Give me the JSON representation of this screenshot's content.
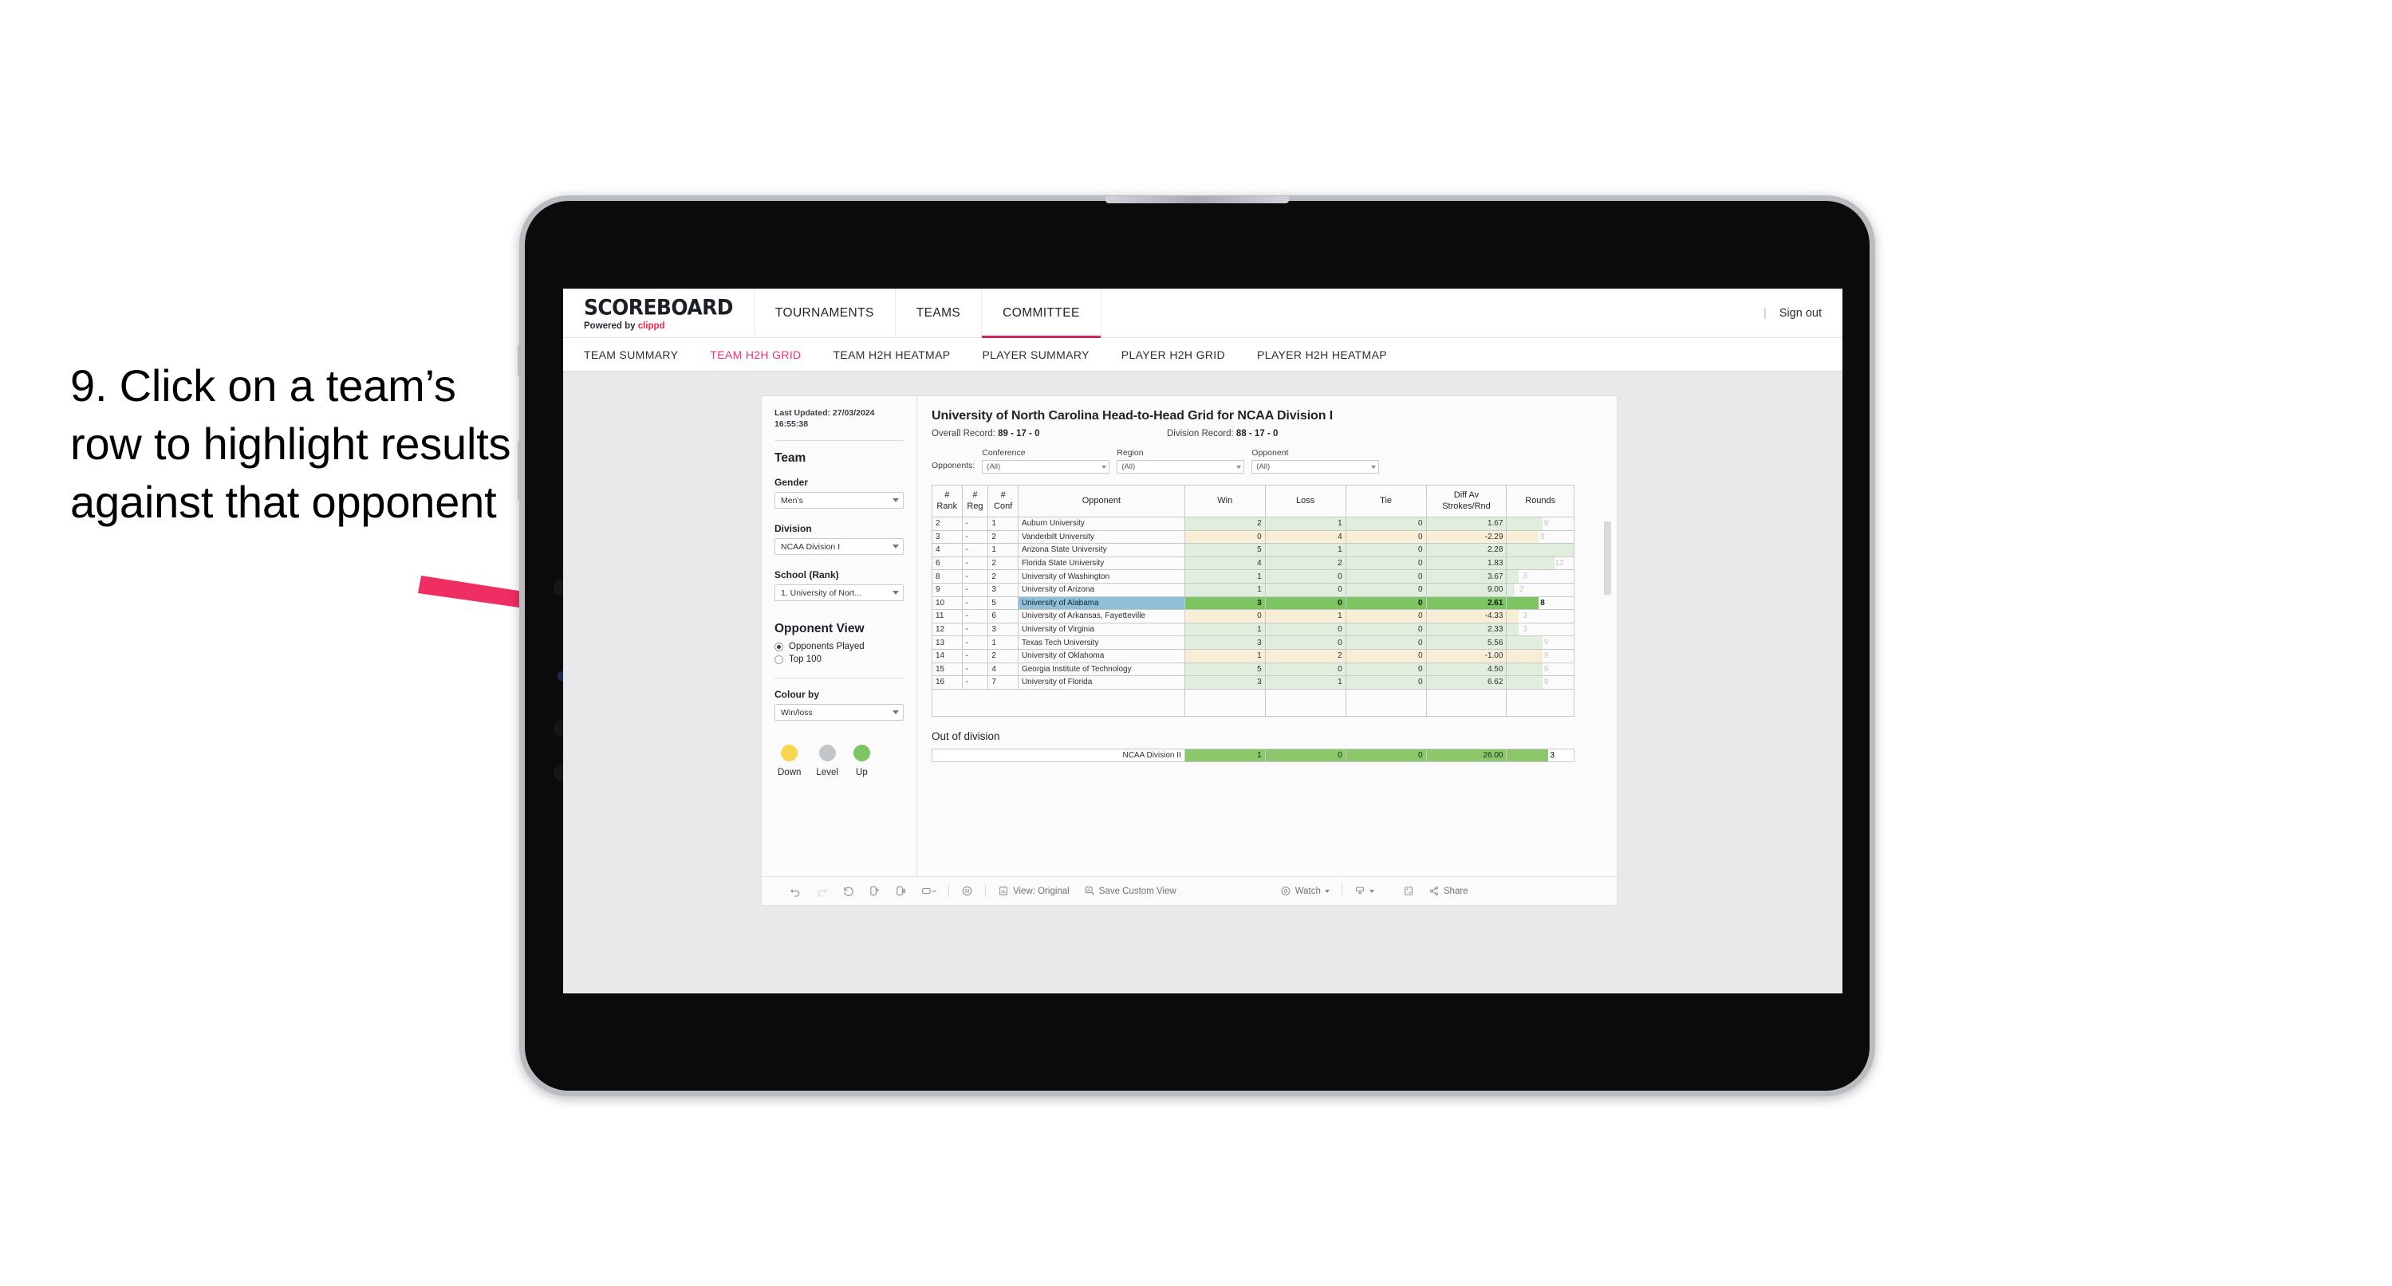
{
  "annotation": {
    "text": "9. Click on a team’s row to highlight results against that opponent",
    "arrow_color": "#ef2f63"
  },
  "topnav": {
    "brand_title": "SCOREBOARD",
    "brand_sub_prefix": "Powered by ",
    "brand_sub_name": "clippd",
    "items": [
      {
        "label": "TOURNAMENTS",
        "active": false
      },
      {
        "label": "TEAMS",
        "active": false
      },
      {
        "label": "COMMITTEE",
        "active": true
      }
    ],
    "divider": "|",
    "sign_out": "Sign out",
    "accent": "#d2245a"
  },
  "subnav": {
    "items": [
      {
        "label": "TEAM SUMMARY",
        "active": false
      },
      {
        "label": "TEAM H2H GRID",
        "active": true
      },
      {
        "label": "TEAM H2H HEATMAP",
        "active": false
      },
      {
        "label": "PLAYER SUMMARY",
        "active": false
      },
      {
        "label": "PLAYER H2H GRID",
        "active": false
      },
      {
        "label": "PLAYER H2H HEATMAP",
        "active": false
      }
    ],
    "active_color": "#e8356b"
  },
  "sidebar": {
    "last_updated_label": "Last Updated: ",
    "last_updated_value": "27/03/2024 16:55:38",
    "team_heading": "Team",
    "gender_label": "Gender",
    "gender_value": "Men’s",
    "division_label": "Division",
    "division_value": "NCAA Division I",
    "school_label": "School (Rank)",
    "school_value": "1. University of Nort...",
    "opponent_view_heading": "Opponent View",
    "opponent_view_options": [
      {
        "label": "Opponents Played",
        "selected": true
      },
      {
        "label": "Top 100",
        "selected": false
      }
    ],
    "colour_by_label": "Colour by",
    "colour_by_value": "Win/loss",
    "legend": [
      {
        "label": "Down",
        "color": "#f6d651"
      },
      {
        "label": "Level",
        "color": "#c3c6c9"
      },
      {
        "label": "Up",
        "color": "#7dc462"
      }
    ]
  },
  "main": {
    "title": "University of North Carolina Head-to-Head Grid for NCAA Division I",
    "overall_record_label": "Overall Record: ",
    "overall_record_value": "89 - 17 - 0",
    "division_record_label": "Division Record: ",
    "division_record_value": "88 - 17 - 0",
    "opponents_label": "Opponents:",
    "filters": [
      {
        "label": "Conference",
        "value": "(All)"
      },
      {
        "label": "Region",
        "value": "(All)"
      },
      {
        "label": "Opponent",
        "value": "(All)"
      }
    ],
    "out_of_division_title": "Out of division",
    "out_of_division_row": {
      "name": "NCAA Division II",
      "win": "1",
      "loss": "0",
      "tie": "0",
      "diff": "26.00",
      "rounds": "3"
    }
  },
  "chart_data": {
    "type": "table",
    "title": "University of North Carolina Head-to-Head Grid for NCAA Division I",
    "columns": [
      "# Rank",
      "# Reg",
      "# Conf",
      "Opponent",
      "Win",
      "Loss",
      "Tie",
      "Diff Av Strokes/Rnd",
      "Rounds"
    ],
    "column_headers_multiline": [
      {
        "line1": "#",
        "line2": "Rank"
      },
      {
        "line1": "#",
        "line2": "Reg"
      },
      {
        "line1": "#",
        "line2": "Conf"
      },
      {
        "line1": "Opponent",
        "line2": ""
      },
      {
        "line1": "Win",
        "line2": ""
      },
      {
        "line1": "Loss",
        "line2": ""
      },
      {
        "line1": "Tie",
        "line2": ""
      },
      {
        "line1": "Diff Av",
        "line2": "Strokes/Rnd"
      },
      {
        "line1": "Rounds",
        "line2": ""
      }
    ],
    "rows": [
      {
        "rank": "2",
        "reg": "-",
        "conf": "1",
        "opponent": "Auburn University",
        "win": "2",
        "loss": "1",
        "tie": "0",
        "diff": "1.67",
        "rounds": "9",
        "state": "up",
        "selected": false
      },
      {
        "rank": "3",
        "reg": "-",
        "conf": "2",
        "opponent": "Vanderbilt University",
        "win": "0",
        "loss": "4",
        "tie": "0",
        "diff": "-2.29",
        "rounds": "8",
        "state": "down",
        "selected": false
      },
      {
        "rank": "4",
        "reg": "-",
        "conf": "1",
        "opponent": "Arizona State University",
        "win": "5",
        "loss": "1",
        "tie": "0",
        "diff": "2.28",
        "rounds": "17",
        "state": "up",
        "selected": false
      },
      {
        "rank": "6",
        "reg": "-",
        "conf": "2",
        "opponent": "Florida State University",
        "win": "4",
        "loss": "2",
        "tie": "0",
        "diff": "1.83",
        "rounds": "12",
        "state": "up",
        "selected": false
      },
      {
        "rank": "8",
        "reg": "-",
        "conf": "2",
        "opponent": "University of Washington",
        "win": "1",
        "loss": "0",
        "tie": "0",
        "diff": "3.67",
        "rounds": "3",
        "state": "up",
        "selected": false
      },
      {
        "rank": "9",
        "reg": "-",
        "conf": "3",
        "opponent": "University of Arizona",
        "win": "1",
        "loss": "0",
        "tie": "0",
        "diff": "9.00",
        "rounds": "2",
        "state": "up",
        "selected": false
      },
      {
        "rank": "10",
        "reg": "-",
        "conf": "5",
        "opponent": "University of Alabama",
        "win": "3",
        "loss": "0",
        "tie": "0",
        "diff": "2.61",
        "rounds": "8",
        "state": "up",
        "selected": true
      },
      {
        "rank": "11",
        "reg": "-",
        "conf": "6",
        "opponent": "University of Arkansas, Fayetteville",
        "win": "0",
        "loss": "1",
        "tie": "0",
        "diff": "-4.33",
        "rounds": "3",
        "state": "down",
        "selected": false
      },
      {
        "rank": "12",
        "reg": "-",
        "conf": "3",
        "opponent": "University of Virginia",
        "win": "1",
        "loss": "0",
        "tie": "0",
        "diff": "2.33",
        "rounds": "3",
        "state": "up",
        "selected": false
      },
      {
        "rank": "13",
        "reg": "-",
        "conf": "1",
        "opponent": "Texas Tech University",
        "win": "3",
        "loss": "0",
        "tie": "0",
        "diff": "5.56",
        "rounds": "9",
        "state": "up",
        "selected": false
      },
      {
        "rank": "14",
        "reg": "-",
        "conf": "2",
        "opponent": "University of Oklahoma",
        "win": "1",
        "loss": "2",
        "tie": "0",
        "diff": "-1.00",
        "rounds": "9",
        "state": "down",
        "selected": false
      },
      {
        "rank": "15",
        "reg": "-",
        "conf": "4",
        "opponent": "Georgia Institute of Technology",
        "win": "5",
        "loss": "0",
        "tie": "0",
        "diff": "4.50",
        "rounds": "9",
        "state": "up",
        "selected": false
      },
      {
        "rank": "16",
        "reg": "-",
        "conf": "7",
        "opponent": "University of Florida",
        "win": "3",
        "loss": "1",
        "tie": "0",
        "diff": "6.62",
        "rounds": "9",
        "state": "up",
        "selected": false
      }
    ]
  },
  "toolbar": {
    "items": [
      {
        "name": "undo",
        "label": ""
      },
      {
        "name": "redo",
        "label": ""
      },
      {
        "name": "revert",
        "label": ""
      },
      {
        "name": "refresh",
        "label": ""
      },
      {
        "name": "pause",
        "label": ""
      },
      {
        "name": "device",
        "label": ""
      }
    ],
    "view_label": "View: Original",
    "save_custom_view_label": "Save Custom View",
    "watch_label": "Watch",
    "share_label": "Share"
  }
}
